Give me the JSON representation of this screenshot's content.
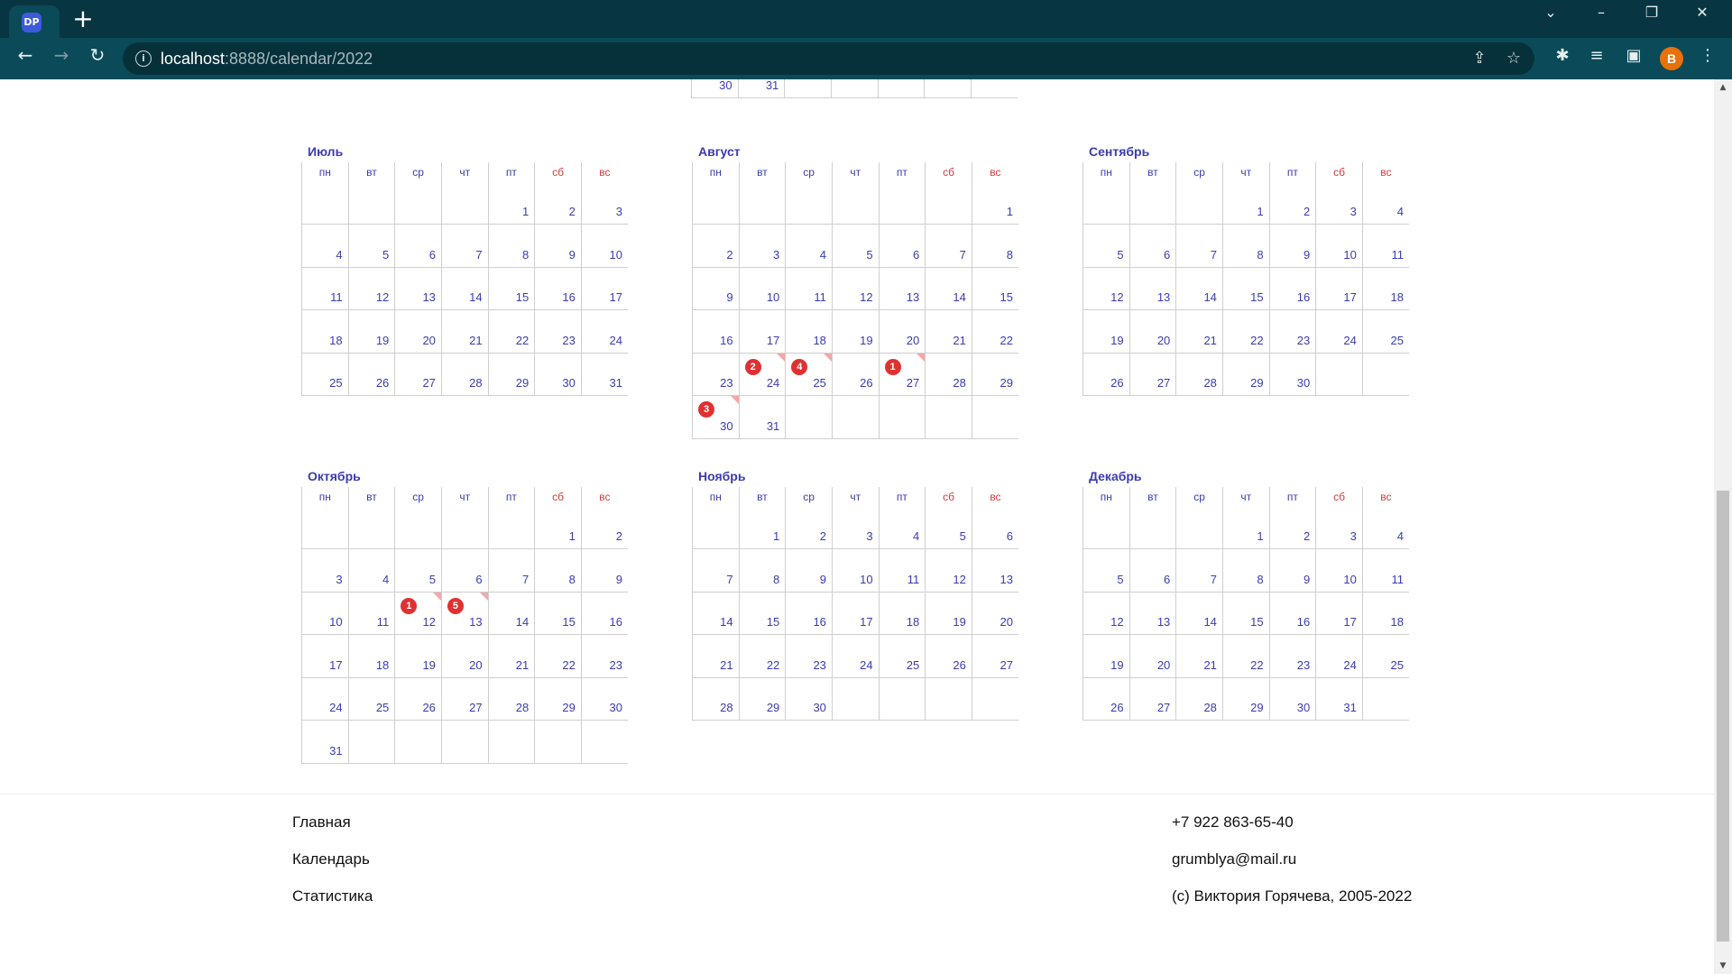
{
  "browser": {
    "tab_favicon": "DP",
    "new_tab": "+",
    "url_host": "localhost",
    "url_path": ":8888/calendar/2022",
    "profile_initial": "B",
    "accent_color": "#073642"
  },
  "weekdays": [
    "пн",
    "вт",
    "ср",
    "чт",
    "пт",
    "сб",
    "вс"
  ],
  "top_fragment": {
    "cells": [
      "30",
      "31",
      "",
      "",
      "",
      "",
      ""
    ]
  },
  "months": [
    {
      "name": "Июль",
      "weeks": [
        [
          "",
          "",
          "",
          "",
          "1",
          "2",
          "3"
        ],
        [
          "4",
          "5",
          "6",
          "7",
          "8",
          "9",
          "10"
        ],
        [
          "11",
          "12",
          "13",
          "14",
          "15",
          "16",
          "17"
        ],
        [
          "18",
          "19",
          "20",
          "21",
          "22",
          "23",
          "24"
        ],
        [
          "25",
          "26",
          "27",
          "28",
          "29",
          "30",
          "31"
        ]
      ],
      "events": []
    },
    {
      "name": "Август",
      "weeks": [
        [
          "",
          "",
          "",
          "",
          "",
          "",
          "1"
        ],
        [
          "2",
          "3",
          "4",
          "5",
          "6",
          "7",
          "8"
        ],
        [
          "9",
          "10",
          "11",
          "12",
          "13",
          "14",
          "15"
        ],
        [
          "16",
          "17",
          "18",
          "19",
          "20",
          "21",
          "22"
        ],
        [
          "23",
          "24",
          "25",
          "26",
          "27",
          "28",
          "29"
        ],
        [
          "30",
          "31",
          "",
          "",
          "",
          "",
          ""
        ]
      ],
      "events": [
        {
          "row": 4,
          "col": 0,
          "count": "3"
        },
        {
          "row": 3,
          "col": 1,
          "count": "2"
        },
        {
          "row": 3,
          "col": 2,
          "count": "4"
        },
        {
          "row": 3,
          "col": 4,
          "count": "1"
        }
      ]
    },
    {
      "name": "Сентябрь",
      "weeks": [
        [
          "",
          "",
          "",
          "1",
          "2",
          "3",
          "4"
        ],
        [
          "5",
          "6",
          "7",
          "8",
          "9",
          "10",
          "11"
        ],
        [
          "12",
          "13",
          "14",
          "15",
          "16",
          "17",
          "18"
        ],
        [
          "19",
          "20",
          "21",
          "22",
          "23",
          "24",
          "25"
        ],
        [
          "26",
          "27",
          "28",
          "29",
          "30",
          "",
          ""
        ]
      ],
      "events": []
    },
    {
      "name": "Октябрь",
      "weeks": [
        [
          "",
          "",
          "",
          "",
          "",
          "1",
          "2"
        ],
        [
          "3",
          "4",
          "5",
          "6",
          "7",
          "8",
          "9"
        ],
        [
          "10",
          "11",
          "12",
          "13",
          "14",
          "15",
          "16"
        ],
        [
          "17",
          "18",
          "19",
          "20",
          "21",
          "22",
          "23"
        ],
        [
          "24",
          "25",
          "26",
          "27",
          "28",
          "29",
          "30"
        ],
        [
          "31",
          "",
          "",
          "",
          "",
          "",
          ""
        ]
      ],
      "events": [
        {
          "row": 1,
          "col": 2,
          "count": "1"
        },
        {
          "row": 1,
          "col": 3,
          "count": "5"
        }
      ]
    },
    {
      "name": "Ноябрь",
      "weeks": [
        [
          "",
          "1",
          "2",
          "3",
          "4",
          "5",
          "6"
        ],
        [
          "7",
          "8",
          "9",
          "10",
          "11",
          "12",
          "13"
        ],
        [
          "14",
          "15",
          "16",
          "17",
          "18",
          "19",
          "20"
        ],
        [
          "21",
          "22",
          "23",
          "24",
          "25",
          "26",
          "27"
        ],
        [
          "28",
          "29",
          "30",
          "",
          "",
          "",
          ""
        ]
      ],
      "events": []
    },
    {
      "name": "Декабрь",
      "weeks": [
        [
          "",
          "",
          "",
          "1",
          "2",
          "3",
          "4"
        ],
        [
          "5",
          "6",
          "7",
          "8",
          "9",
          "10",
          "11"
        ],
        [
          "12",
          "13",
          "14",
          "15",
          "16",
          "17",
          "18"
        ],
        [
          "19",
          "20",
          "21",
          "22",
          "23",
          "24",
          "25"
        ],
        [
          "26",
          "27",
          "28",
          "29",
          "30",
          "31",
          ""
        ]
      ],
      "events": []
    }
  ],
  "footer": {
    "links": [
      "Главная",
      "Календарь",
      "Статистика"
    ],
    "phone": "+7 922 863-65-40",
    "email": "grumblya@mail.ru",
    "copyright": "(c) Виктория Горячева, 2005-2022"
  }
}
